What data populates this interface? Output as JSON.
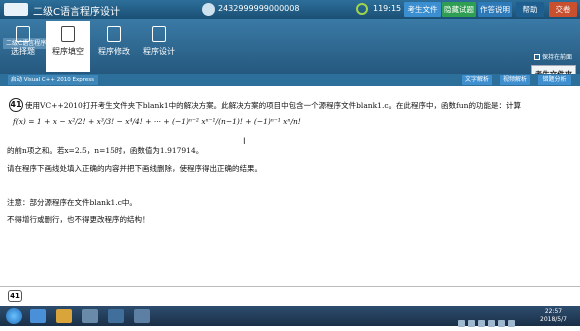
{
  "header": {
    "title": "二级C语言程序设计",
    "candidate_id": "2432999999000008",
    "time_left": "119:15",
    "buttons": [
      "考生文件夹",
      "隐藏试题",
      "作答说明",
      "帮助",
      "交卷"
    ]
  },
  "toolbar": {
    "tab_strip": "二级C语言程序设计",
    "items": [
      {
        "label": "选择题",
        "icon": "list-icon",
        "active": false
      },
      {
        "label": "程序填空",
        "icon": "edit-icon",
        "active": true
      },
      {
        "label": "程序修改",
        "icon": "folder-icon",
        "active": false
      },
      {
        "label": "程序设计",
        "icon": "monitor-icon",
        "active": false
      }
    ],
    "keep_on_top": "保持在前面",
    "student_folder": "考生文件夹"
  },
  "subbar": {
    "env_label": "启动 Visual C++ 2010 Express",
    "buttons": [
      "文字解析",
      "视频解析",
      "错题分析"
    ]
  },
  "question": {
    "number": "41",
    "line1": "使用VC++2010打开考生文件夹下blank1中的解决方案。此解决方案的项目中包含一个源程序文件blank1.c。在此程序中，函数fun的功能是：计算",
    "formula": "f(x) = 1 + x − x²/2! + x³/3! − x⁴/4! + ··· + (−1)ⁿ⁻² xⁿ⁻¹/(n−1)! + (−1)ⁿ⁻¹ xⁿ/n!",
    "line3": "的前n项之和。若x=2.5，n=15时，函数值为1.917914。",
    "line4": "请在程序下画线处填入正确的内容并把下画线删除，使程序得出正确的结果。",
    "line5": "注意：部分源程序在文件blank1.c中。",
    "line6": "不得增行或删行，也不得更改程序的结构！"
  },
  "bottom": {
    "page": "41"
  },
  "taskbar": {
    "time": "22:57",
    "date": "2018/5/7"
  }
}
